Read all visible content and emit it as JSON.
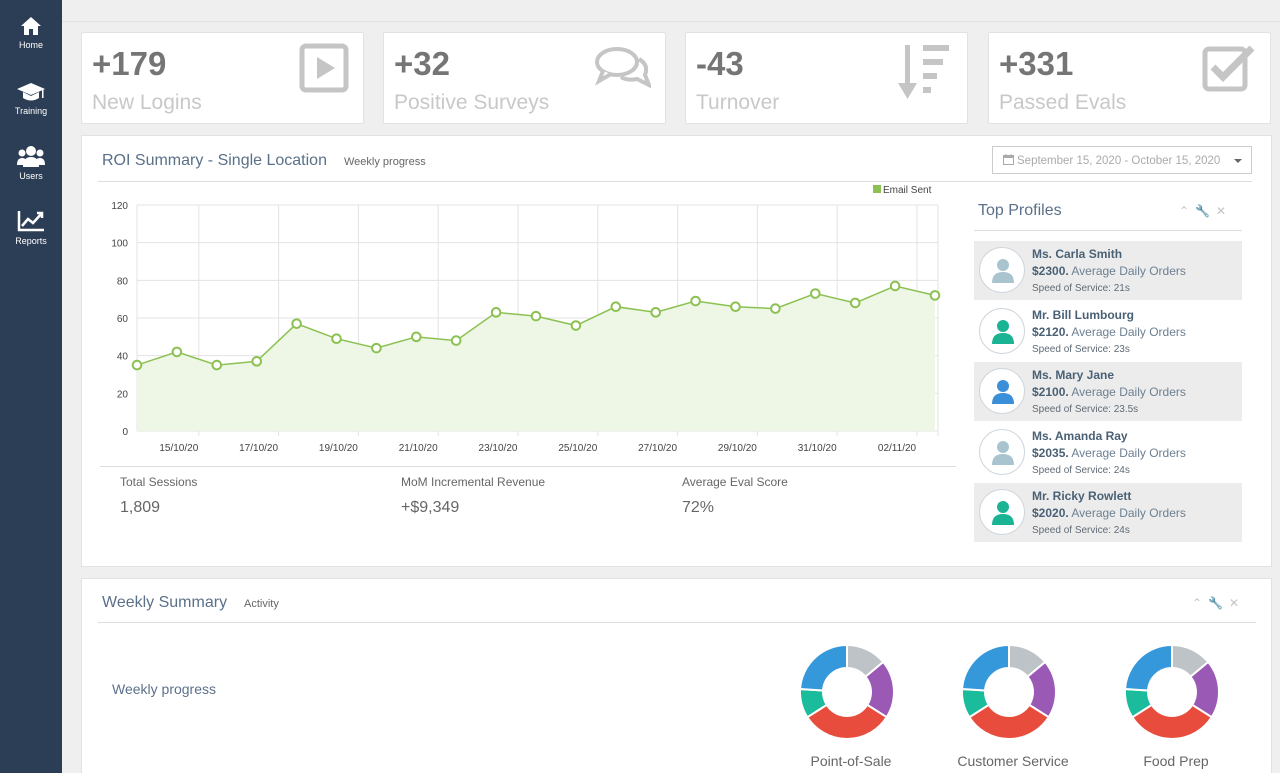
{
  "sidebar": {
    "items": [
      {
        "label": "Home",
        "icon": "home-icon"
      },
      {
        "label": "Training",
        "icon": "graduation-cap-icon"
      },
      {
        "label": "Users",
        "icon": "users-icon"
      },
      {
        "label": "Reports",
        "icon": "line-chart-icon"
      }
    ]
  },
  "stats": [
    {
      "value": "+179",
      "label": "New Logins",
      "icon": "play-icon"
    },
    {
      "value": "+32",
      "label": "Positive Surveys",
      "icon": "comments-icon"
    },
    {
      "value": "-43",
      "label": "Turnover",
      "icon": "sort-amount-down-icon"
    },
    {
      "value": "+331",
      "label": "Passed Evals",
      "icon": "checkbox-icon"
    }
  ],
  "roi": {
    "title": "ROI Summary - Single Location",
    "subtitle": "Weekly progress",
    "date_range": "September 15, 2020 - October 15, 2020",
    "summary": [
      {
        "label": "Total Sessions",
        "value": "1,809"
      },
      {
        "label": "MoM Incremental Revenue",
        "value": "+$9,349"
      },
      {
        "label": "Average Eval Score",
        "value": "72%"
      }
    ]
  },
  "chart_data": {
    "type": "area",
    "legend": {
      "label": "Email Sent",
      "placement": "top-right"
    },
    "line_color": "#8cc152",
    "fill_color": "#eef6e6",
    "ylim": [
      0,
      120
    ],
    "yticks": [
      0,
      20,
      40,
      60,
      80,
      100,
      120
    ],
    "xticks": [
      "15/10/20",
      "17/10/20",
      "19/10/20",
      "21/10/20",
      "23/10/20",
      "25/10/20",
      "27/10/20",
      "29/10/20",
      "31/10/20",
      "02/11/20"
    ],
    "grid": true,
    "series": [
      {
        "name": "Email Sent",
        "values": [
          35,
          42,
          35,
          37,
          57,
          49,
          44,
          50,
          48,
          63,
          61,
          56,
          66,
          63,
          69,
          66,
          65,
          73,
          68,
          77,
          72
        ]
      }
    ]
  },
  "top_profiles": {
    "title": "Top Profiles",
    "items": [
      {
        "name": "Ms. Carla Smith",
        "amount": "$2300.",
        "metric": "Average Daily Orders",
        "speed": "Speed of Service: 21s",
        "avatar_color": "#a9c4cf"
      },
      {
        "name": "Mr. Bill Lumbourg",
        "amount": "$2120.",
        "metric": "Average Daily Orders",
        "speed": "Speed of Service: 23s",
        "avatar_color": "#1ab394"
      },
      {
        "name": "Ms. Mary Jane",
        "amount": "$2100.",
        "metric": "Average Daily Orders",
        "speed": "Speed of Service: 23.5s",
        "avatar_color": "#3b8fd8"
      },
      {
        "name": "Ms. Amanda Ray",
        "amount": "$2035.",
        "metric": "Average Daily Orders",
        "speed": "Speed of Service: 24s",
        "avatar_color": "#a9c4cf"
      },
      {
        "name": "Mr. Ricky Rowlett",
        "amount": "$2020.",
        "metric": "Average Daily Orders",
        "speed": "Speed of Service: 24s",
        "avatar_color": "#1ab394"
      }
    ]
  },
  "weekly": {
    "title": "Weekly Summary",
    "subtitle": "Activity",
    "progress_label": "Weekly progress",
    "donuts": [
      {
        "label": "Point-of-Sale",
        "slices": [
          {
            "value": 14,
            "color": "#bdc3c7"
          },
          {
            "value": 20,
            "color": "#9b59b6"
          },
          {
            "value": 32,
            "color": "#e74c3c"
          },
          {
            "value": 10,
            "color": "#1abc9c"
          },
          {
            "value": 24,
            "color": "#3498db"
          }
        ]
      },
      {
        "label": "Customer Service",
        "slices": [
          {
            "value": 14,
            "color": "#bdc3c7"
          },
          {
            "value": 20,
            "color": "#9b59b6"
          },
          {
            "value": 32,
            "color": "#e74c3c"
          },
          {
            "value": 10,
            "color": "#1abc9c"
          },
          {
            "value": 24,
            "color": "#3498db"
          }
        ]
      },
      {
        "label": "Food Prep",
        "slices": [
          {
            "value": 14,
            "color": "#bdc3c7"
          },
          {
            "value": 20,
            "color": "#9b59b6"
          },
          {
            "value": 32,
            "color": "#e74c3c"
          },
          {
            "value": 10,
            "color": "#1abc9c"
          },
          {
            "value": 24,
            "color": "#3498db"
          }
        ]
      }
    ]
  }
}
